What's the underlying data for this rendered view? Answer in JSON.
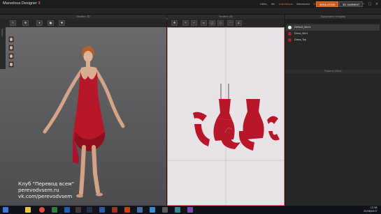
{
  "titlebar": {
    "app_name": "Marvelous",
    "app_suffix": "Designer",
    "app_version": "3",
    "user_items": [
      "Hello,",
      "Mr.",
      "marvelous",
      "Advanced",
      "24 Days"
    ],
    "tab_simulation": "SIMULATION",
    "tab_3d": "3D GARMENT"
  },
  "menu": [
    "Fichier",
    "Editer",
    "Vêtement",
    "Avatar",
    "Fibres",
    "Environnement",
    "Vends",
    "Fenêtre",
    "Réglages",
    "Aide"
  ],
  "window3d": {
    "title": "Fenêtre 3D"
  },
  "window2d": {
    "title": "Fenêtre 2D"
  },
  "object_browser": {
    "title": "Explorateur d'objets",
    "tabs": [
      "SCENE",
      "FABRIC",
      "BUTTONS",
      "BUTTONHOLES",
      "PINS"
    ],
    "items": [
      {
        "label": "Default_fabric",
        "color": "#ffffff"
      },
      {
        "label": "Dress_Skirt",
        "color": "#c0172a"
      },
      {
        "label": "Dress_Top",
        "color": "#c0172a"
      }
    ]
  },
  "property_editor": {
    "title": "Property Editor"
  },
  "watermark": [
    "Клуб \"Перевод всем\"",
    "perevodvsem.ru",
    "vk.com/perevodvsem"
  ],
  "tray": {
    "time": "12:38",
    "date": "25/06/2017"
  },
  "colors": {
    "accent": "#c85a1a",
    "dress": "#c0172a"
  }
}
